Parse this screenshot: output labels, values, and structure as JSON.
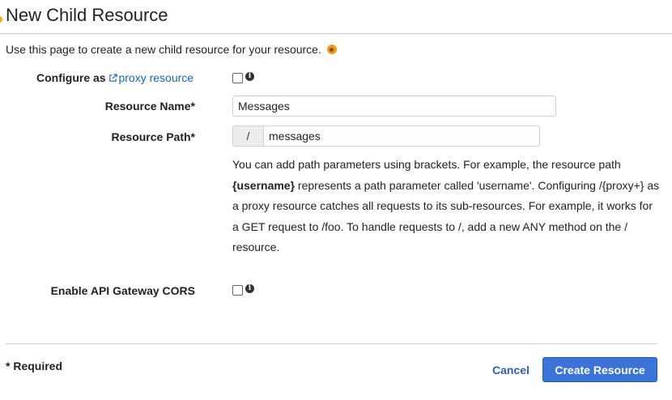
{
  "page": {
    "title": "New Child Resource",
    "intro": "Use this page to create a new child resource for your resource."
  },
  "form": {
    "proxy_label_prefix": "Configure as",
    "proxy_label_link": "proxy resource",
    "resource_name_label": "Resource Name*",
    "resource_name_value": "Messages",
    "resource_path_label": "Resource Path*",
    "resource_path_prefix": "/",
    "resource_path_value": "messages",
    "help_part1": "You can add path parameters using brackets. For example, the resource path ",
    "help_bold": "{username}",
    "help_part2": " represents a path parameter called 'username'. Configuring /{proxy+} as a proxy resource catches all requests to its sub-resources. For example, it works for a GET request to /foo. To handle requests to /, add a new ANY method on the / resource.",
    "cors_label": "Enable API Gateway CORS",
    "proxy_checked": false,
    "cors_checked": false
  },
  "footer": {
    "required_note": "* Required",
    "cancel_label": "Cancel",
    "create_label": "Create Resource"
  },
  "icons": {
    "info": "i"
  },
  "colors": {
    "primary_button": "#3b73d6",
    "link": "#1a63b8",
    "hint": "#f39c12"
  }
}
